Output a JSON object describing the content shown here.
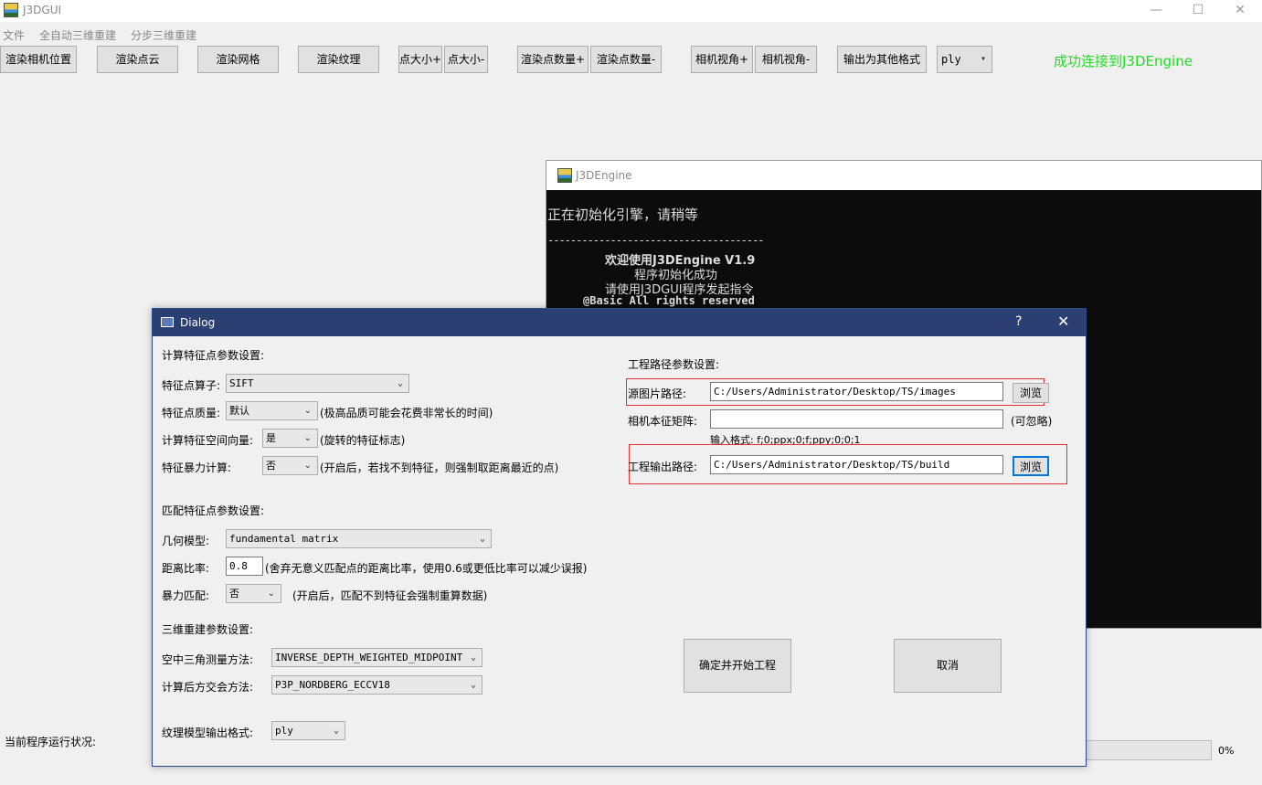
{
  "window": {
    "title": "J3DGUI",
    "minimize": "—",
    "maximize": "☐",
    "close": "✕"
  },
  "menu": [
    "文件",
    "全自动三维重建",
    "分步三维重建"
  ],
  "toolbar": {
    "render_camera": "渲染相机位置",
    "render_points": "渲染点云",
    "render_mesh": "渲染网格",
    "render_texture": "渲染纹理",
    "point_size_up": "点大小+",
    "point_size_down": "点大小-",
    "point_count_up": "渲染点数量+",
    "point_count_down": "渲染点数量-",
    "camera_view_up": "相机视角+",
    "camera_view_down": "相机视角-",
    "export_other": "输出为其他格式",
    "format_value": "ply"
  },
  "status_text": "成功连接到J3DEngine",
  "run_status_label": "当前程序运行状况:",
  "progress": {
    "percent_text": "0%",
    "value": 0
  },
  "console": {
    "title": "J3DEngine",
    "lines": [
      "正在初始化引擎，请稍等",
      "--------------------------------------",
      "欢迎使用J3DEngine V1.9",
      "程序初始化成功",
      "请使用J3DGUI程序发起指令",
      "@Basic All rights reserved"
    ]
  },
  "dialog": {
    "title": "Dialog",
    "help": "?",
    "close": "✕",
    "feature_section": "计算特征点参数设置:",
    "feature_operator_label": "特征点算子:",
    "feature_operator_value": "SIFT",
    "feature_quality_label": "特征点质量:",
    "feature_quality_value": "默认",
    "feature_quality_hint": "(极高品质可能会花费非常长的时间)",
    "upright_label": "计算特征空间向量:",
    "upright_value": "是",
    "upright_hint": "(旋转的特征标志)",
    "force_feature_label": "特征暴力计算:",
    "force_feature_value": "否",
    "force_feature_hint": "(开启后，若找不到特征，则强制取距离最近的点)",
    "match_section": "匹配特征点参数设置:",
    "geometry_model_label": "几何模型:",
    "geometry_model_value": "fundamental matrix",
    "distance_ratio_label": "距离比率:",
    "distance_ratio_value": "0.8",
    "distance_ratio_hint": "(舍弃无意义匹配点的距离比率，使用0.6或更低比率可以减少误报)",
    "force_match_label": "暴力匹配:",
    "force_match_value": "否",
    "force_match_hint": "(开启后，匹配不到特征会强制重算数据)",
    "recon_section": "三维重建参数设置:",
    "triangulation_label": "空中三角测量方法:",
    "triangulation_value": "INVERSE_DEPTH_WEIGHTED_MIDPOINT",
    "resection_label": "计算后方交会方法:",
    "resection_value": "P3P_NORDBERG_ECCV18",
    "texture_format_label": "纹理模型输出格式:",
    "texture_format_value": "ply",
    "path_section": "工程路径参数设置:",
    "source_path_label": "源图片路径:",
    "source_path_value": "C:/Users/Administrator/Desktop/TS/images",
    "browse": "浏览",
    "intrinsic_label": "相机本征矩阵:",
    "intrinsic_value": "",
    "intrinsic_hint": "(可忽略)",
    "intrinsic_format": "输入格式: f;0;ppx;0;f;ppy;0;0;1",
    "output_path_label": "工程输出路径:",
    "output_path_value": "C:/Users/Administrator/Desktop/TS/build",
    "confirm_button": "确定并开始工程",
    "cancel_button": "取消"
  }
}
